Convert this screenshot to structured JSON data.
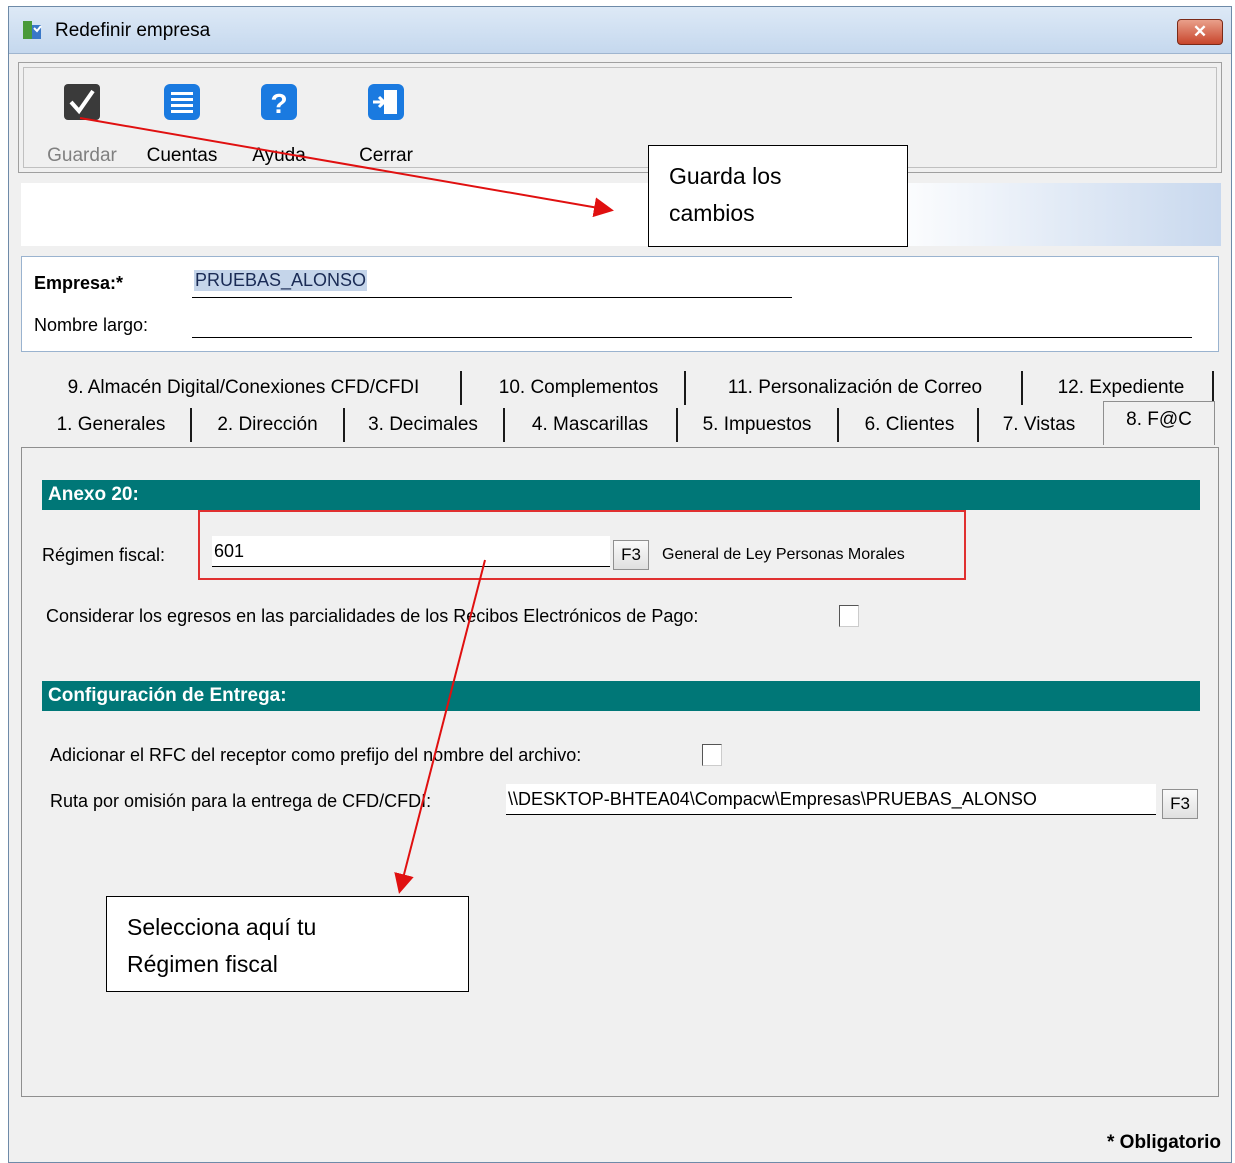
{
  "window": {
    "title": "Redefinir empresa",
    "close_label": "✕"
  },
  "toolbar": {
    "buttons": [
      {
        "label": "Guardar",
        "icon": "check-icon",
        "enabled": false
      },
      {
        "label": "Cuentas",
        "icon": "list-icon",
        "enabled": true
      },
      {
        "label": "Ayuda",
        "icon": "help-icon",
        "enabled": true
      },
      {
        "label": "Cerrar",
        "icon": "exit-icon",
        "enabled": true
      }
    ]
  },
  "header": {
    "company_label": "Empresa:*",
    "company_value": "PRUEBAS_ALONSO",
    "long_name_label": "Nombre largo:",
    "long_name_value": ""
  },
  "tabs": {
    "row_back": [
      "9. Almacén Digital/Conexiones CFD/CFDI",
      "10. Complementos",
      "11. Personalización de Correo",
      "12. Expediente"
    ],
    "row_front": [
      "1. Generales",
      "2. Dirección",
      "3. Decimales",
      "4. Mascarillas",
      "5. Impuestos",
      "6. Clientes",
      "7. Vistas",
      "8. F@C"
    ],
    "active": "8. F@C"
  },
  "anexo20": {
    "section_title": "Anexo 20:",
    "regimen_label": "Régimen fiscal:",
    "regimen_value": "601",
    "regimen_button": "F3",
    "regimen_description": "General de Ley Personas Morales",
    "egresos_label": "Considerar los egresos en las parcialidades de los Recibos Electrónicos de Pago:",
    "egresos_checked": false
  },
  "entrega": {
    "section_title": "Configuración de Entrega:",
    "rfc_prefix_label": "Adicionar el RFC del receptor como prefijo del nombre del archivo:",
    "rfc_prefix_checked": false,
    "ruta_label": "Ruta por omisión para la entrega de CFD/CFDI:",
    "ruta_value": "\\\\DESKTOP-BHTEA04\\Compacw\\Empresas\\PRUEBAS_ALONSO",
    "ruta_button": "F3"
  },
  "annotations": {
    "callout_save_line1": "Guarda los",
    "callout_save_line2": "cambios",
    "callout_regimen_line1": "Selecciona aquí tu",
    "callout_regimen_line2": "Régimen fiscal",
    "arrow_color": "#e01010"
  },
  "footer": {
    "required_note": "* Obligatorio"
  },
  "colors": {
    "section_bar": "#007777",
    "highlight_box": "#e03030",
    "selection": "#c5d5ea"
  }
}
